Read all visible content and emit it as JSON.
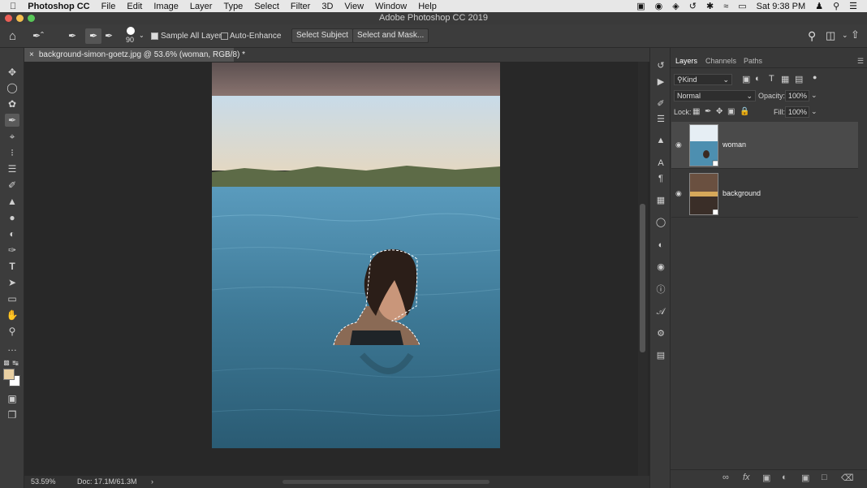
{
  "menubar": {
    "apple": "",
    "app": "Photoshop CC",
    "items": [
      "File",
      "Edit",
      "Image",
      "Layer",
      "Type",
      "Select",
      "Filter",
      "3D",
      "View",
      "Window",
      "Help"
    ],
    "clock": "Sat 9:38 PM"
  },
  "window": {
    "title": "Adobe Photoshop CC 2019"
  },
  "options": {
    "brush_size": "90",
    "sample_all_layers": {
      "label": "Sample All Layers",
      "checked": true
    },
    "auto_enhance": {
      "label": "Auto-Enhance",
      "checked": false
    },
    "select_subject": "Select Subject",
    "select_and_mask": "Select and Mask..."
  },
  "document": {
    "tab_title": "background-simon-goetz.jpg @ 53.6% (woman, RGB/8) *"
  },
  "status": {
    "zoom": "53.59%",
    "doc": "Doc: 17.1M/61.3M",
    "arrow": "›"
  },
  "panel": {
    "tabs": [
      "Layers",
      "Channels",
      "Paths"
    ],
    "filter_kind": "Kind",
    "blend_mode": "Normal",
    "opacity_label": "Opacity:",
    "opacity_value": "100%",
    "lock_label": "Lock:",
    "fill_label": "Fill:",
    "fill_value": "100%",
    "layers": [
      {
        "name": "woman",
        "visible": true,
        "selected": true
      },
      {
        "name": "background",
        "visible": true,
        "selected": false
      }
    ]
  },
  "colors": {
    "foreground": "#e8cfa2",
    "background": "#ffffff",
    "accent": "#5a5a5a"
  },
  "icons": {
    "toolbar": [
      "move-icon",
      "marquee-icon",
      "lasso-icon",
      "quick-selection-icon",
      "crop-icon",
      "eyedropper-icon",
      "healing-icon",
      "brush-icon",
      "stamp-icon",
      "blur-icon",
      "dodge-icon",
      "pen-icon",
      "type-icon",
      "path-select-icon",
      "rectangle-icon",
      "hand-icon",
      "zoom-icon",
      "more-icon"
    ]
  }
}
